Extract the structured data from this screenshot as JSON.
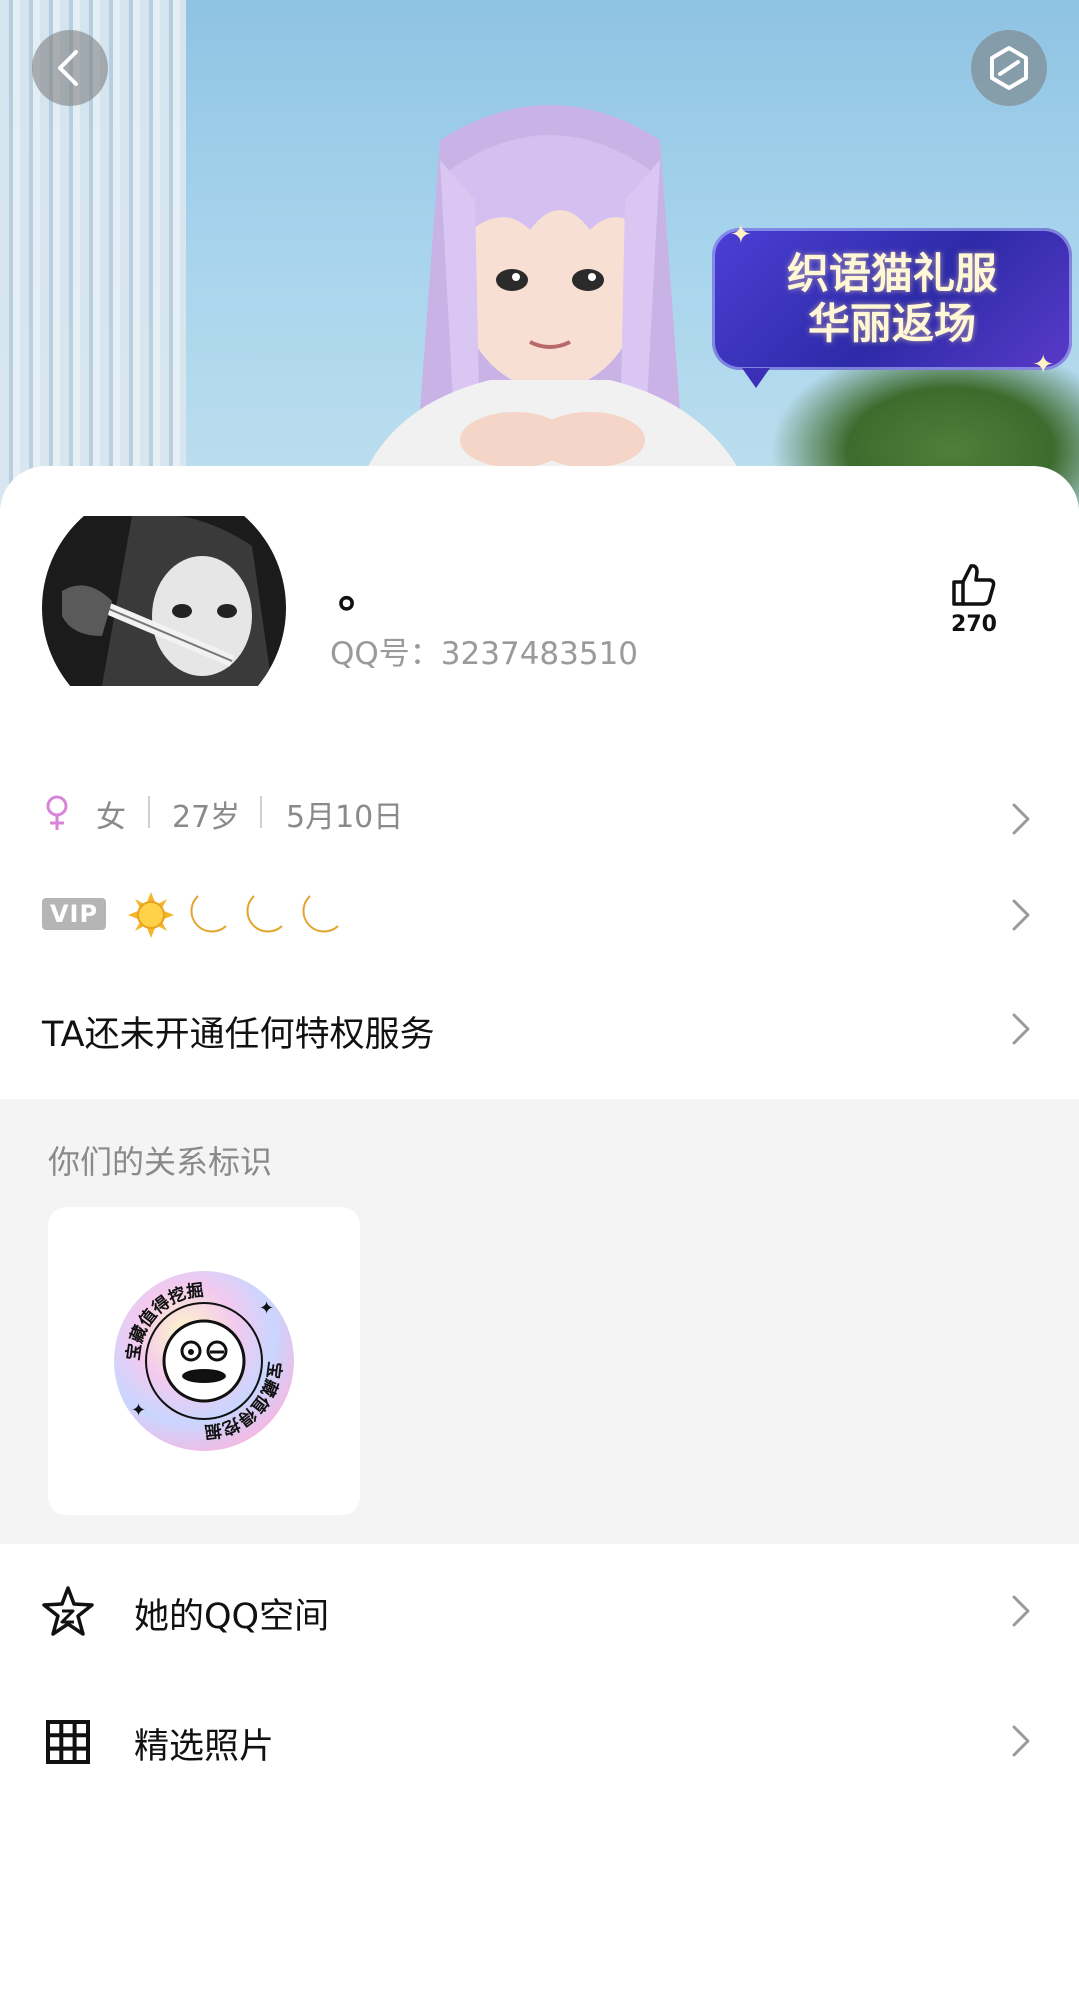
{
  "header": {
    "back_icon": "chevron-left-icon",
    "more_icon": "hexagon-icon",
    "promo": {
      "line1": "织语猫礼服",
      "line2": "华丽返场"
    }
  },
  "profile": {
    "nickname": "。",
    "qq_label": "QQ号：3237483510",
    "like_icon": "thumbs-up-icon",
    "like_count": "270"
  },
  "info": {
    "gender_icon": "female-symbol-icon",
    "gender": "女",
    "age": "27岁",
    "birthday": "5月10日"
  },
  "vip": {
    "badge": "VIP",
    "level_icons": [
      "sun-icon",
      "moon-icon",
      "moon-icon",
      "moon-icon"
    ]
  },
  "privilege": {
    "text": "TA还未开通任何特权服务"
  },
  "relationship": {
    "title": "你们的关系标识",
    "badge_text": "宝藏值得挖掘"
  },
  "links": [
    {
      "label": "她的QQ空间",
      "icon": "star-icon"
    },
    {
      "label": "精选照片",
      "icon": "grid-icon"
    }
  ],
  "colors": {
    "female_pink": "#d884d8",
    "secondary_text": "#8a8a8a",
    "section_bg": "#f4f4f4"
  }
}
